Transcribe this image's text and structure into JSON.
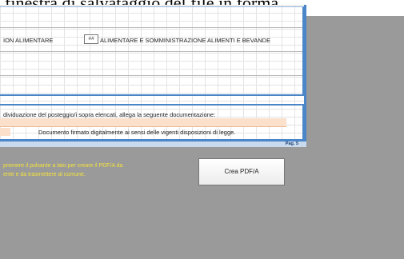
{
  "header": {
    "partial_title": "finestra di salvataggio del file in forma"
  },
  "sheet": {
    "category_left": "ION ALIMENTARE",
    "category_tag": "##",
    "category_right": "ALIMENTARE E SOMMINISTRAZIONE ALIMENTI E BEVANDE",
    "intro_text": "dividuazione del posteggio/i sopra elencati, allega la seguente documentazione:",
    "signed_text": "Documento firmato digitalmente ai sensi delle vigenti disposizioni di legge.",
    "page_label": "Pag. 5"
  },
  "note": {
    "line1": "premere il pulsante a lato per creare il PDF/A da",
    "line2": "ente e da trasmettere al comune."
  },
  "actions": {
    "create_pdf_label": "Crea PDF/A"
  },
  "colors": {
    "frame_blue": "#4a86c8",
    "field_peach": "#fbe0cc",
    "note_yellow": "#f3e23e",
    "background_gray": "#9a9a9a"
  }
}
